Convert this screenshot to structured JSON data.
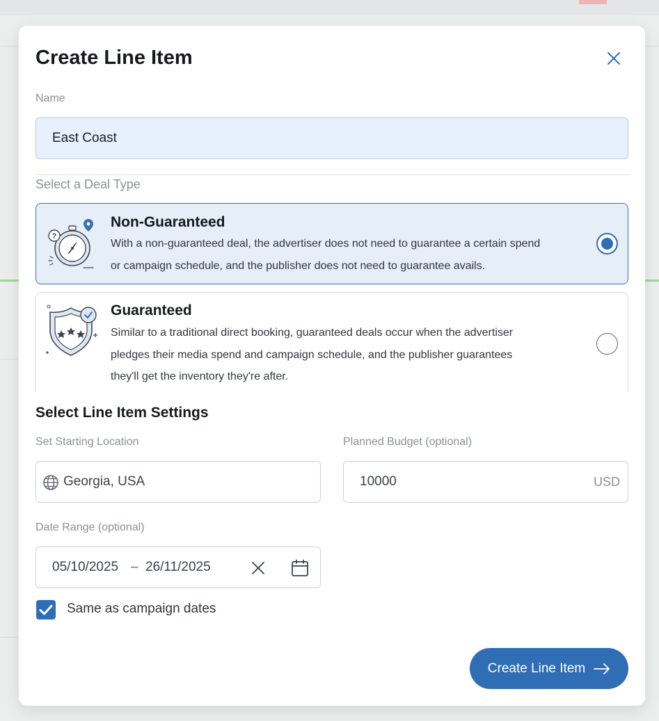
{
  "modal": {
    "title": "Create Line Item",
    "close_icon": "close-icon"
  },
  "name_field": {
    "label": "Name",
    "value": "East Coast"
  },
  "deal_type": {
    "label": "Select a Deal Type",
    "options": [
      {
        "title": "Non-Guaranteed",
        "description_line1": "With a non-guaranteed deal, the advertiser does not need to guarantee a certain spend",
        "description_line2": "or campaign schedule, and the publisher does not need to guarantee avails.",
        "icon": "stopwatch-compass-icon",
        "selected": true
      },
      {
        "title": "Guaranteed",
        "description_line1": "Similar to a traditional direct booking, guaranteed deals occur when the advertiser",
        "description_line2": "pledges their media spend and campaign schedule, and the publisher guarantees",
        "description_line3": "they'll get the inventory they're after.",
        "icon": "shield-check-icon",
        "selected": false
      }
    ]
  },
  "settings": {
    "title": "Select Line Item Settings",
    "location": {
      "label": "Set Starting Location",
      "value": "Georgia, USA",
      "icon": "globe-icon"
    },
    "budget": {
      "label_main": "Planned Budget ",
      "label_optional": "(optional)",
      "value": "10000",
      "currency": "USD"
    },
    "date_range": {
      "label_main": "Date Range ",
      "label_optional": "(optional)",
      "start": "05/10/2025",
      "separator": "–",
      "end": "26/11/2025",
      "clear_icon": "clear-icon",
      "calendar_icon": "calendar-icon"
    },
    "same_as_campaign": {
      "label": "Same as campaign dates",
      "checked": true
    }
  },
  "submit": {
    "label": "Create Line Item",
    "icon": "arrow-right-icon"
  },
  "colors": {
    "primary": "#2f6db5",
    "selected_bg": "#e6eef8",
    "input_bg": "#e7f0fd"
  }
}
